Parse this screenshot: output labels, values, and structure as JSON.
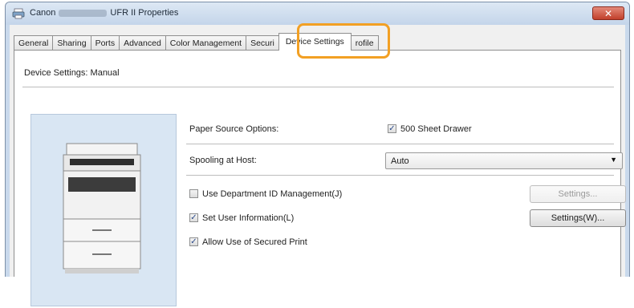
{
  "window": {
    "title_prefix": "Canon",
    "title_suffix": "UFR II Properties",
    "close_label": "✕"
  },
  "tabs": [
    {
      "label": "General"
    },
    {
      "label": "Sharing"
    },
    {
      "label": "Ports"
    },
    {
      "label": "Advanced"
    },
    {
      "label": "Color Management"
    },
    {
      "label": "Securi"
    },
    {
      "label": "Device Settings"
    },
    {
      "label": "rofile"
    }
  ],
  "panel": {
    "title": "Device Settings: Manual",
    "paper_source_label": "Paper Source Options:",
    "drawer_label": "500 Sheet Drawer",
    "drawer_checked": true,
    "spooling_label": "Spooling at Host:",
    "spooling_value": "Auto",
    "dept_id_label": "Use Department ID Management(J)",
    "dept_id_checked": false,
    "dept_settings_label": "Settings...",
    "user_info_label": "Set User Information(L)",
    "user_info_checked": true,
    "user_settings_label": "Settings(W)...",
    "secured_print_label": "Allow Use of Secured Print",
    "secured_print_checked": true
  },
  "colors": {
    "highlight": "#f2a024",
    "printer_bg": "#d9e6f3"
  }
}
